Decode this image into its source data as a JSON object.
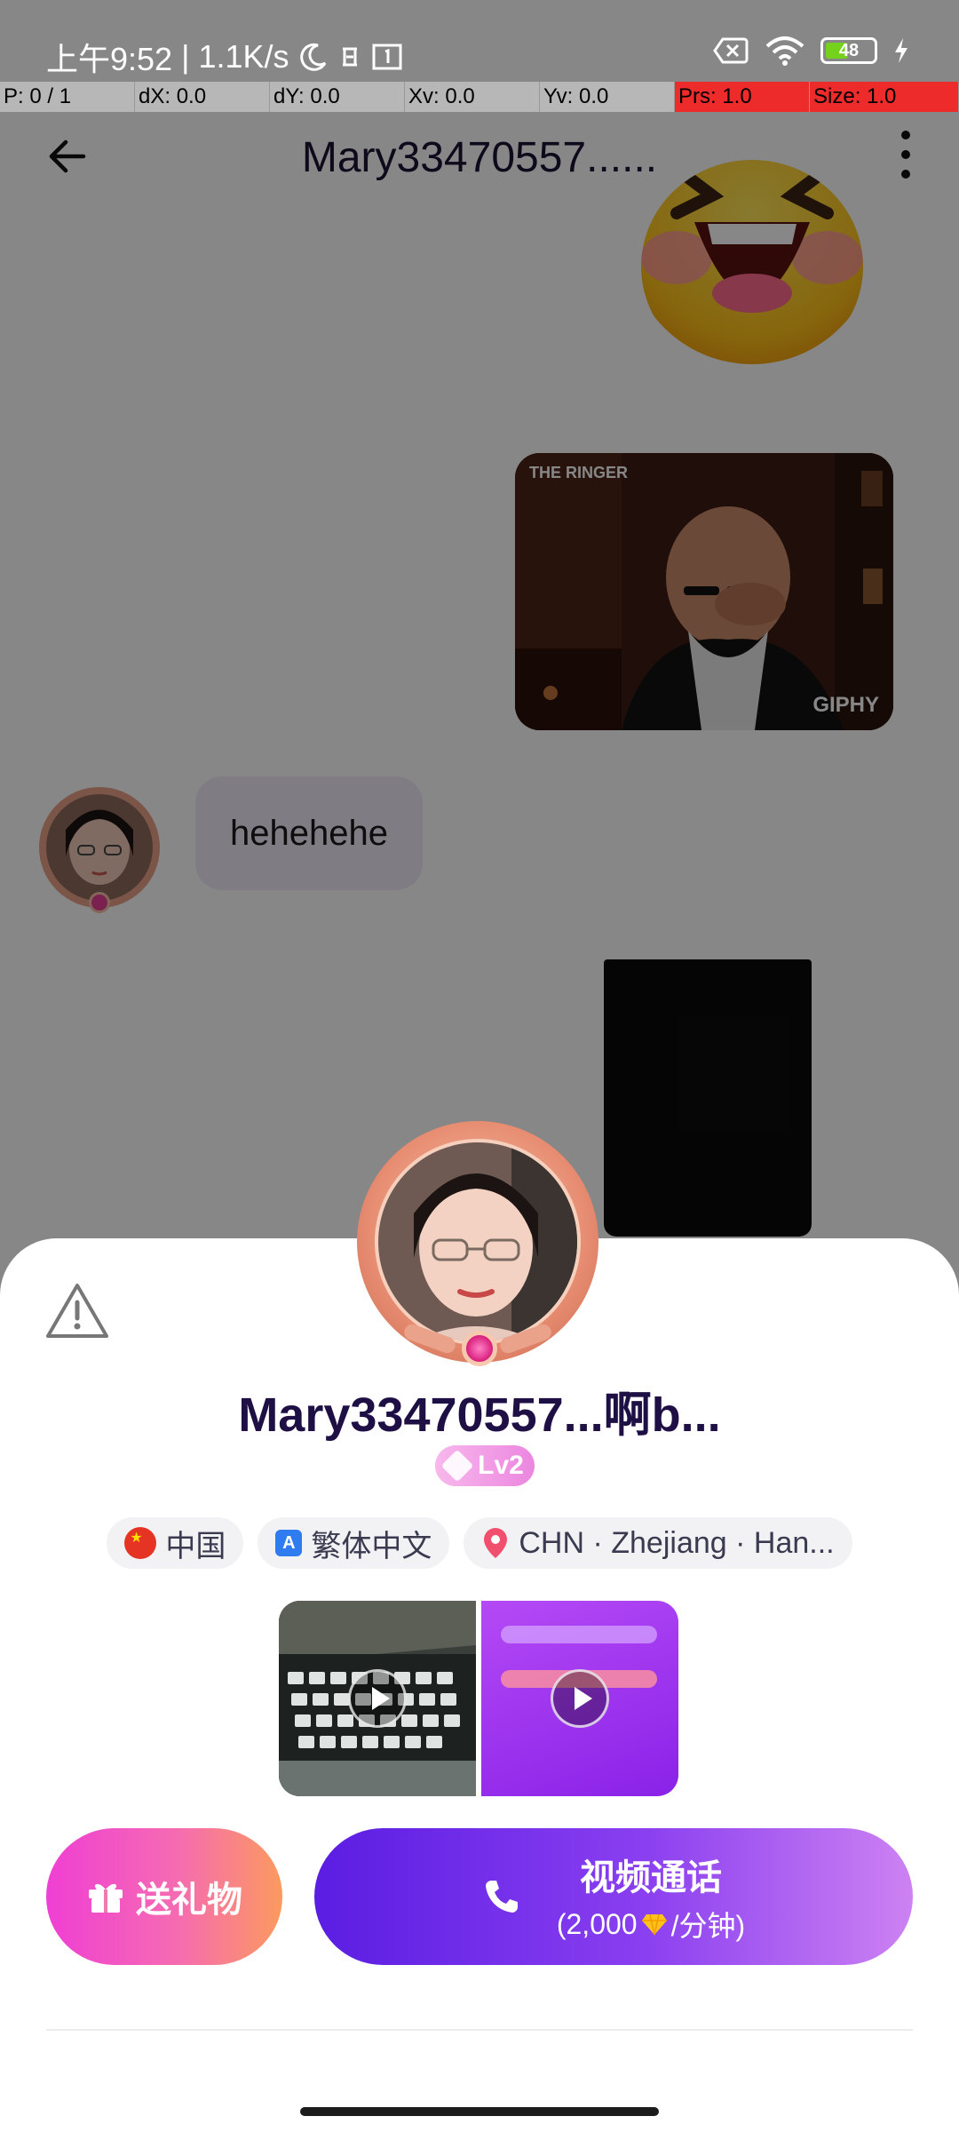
{
  "status_bar": {
    "time": "上午9:52",
    "separator": "|",
    "net_speed": "1.1K/s",
    "battery_level": "48",
    "battery_percent": 48,
    "icons": [
      "moon-icon",
      "sync-icon",
      "sim-icon",
      "no-sim-icon",
      "wifi-icon",
      "battery-icon",
      "charging-icon"
    ]
  },
  "debug_overlay": {
    "p": "P: 0 / 1",
    "dx": "dX: 0.0",
    "dy": "dY: 0.0",
    "xv": "Xv: 0.0",
    "yv": "Yv: 0.0",
    "prs": "Prs: 1.0",
    "size": "Size: 1.0"
  },
  "chat": {
    "title": "Mary33470557......",
    "messages": [
      {
        "type": "sticker",
        "direction": "outgoing",
        "desc": "laughing-emoji"
      },
      {
        "type": "gif",
        "direction": "outgoing",
        "source_badge": "THE RINGER",
        "powered_by": "GIPHY"
      },
      {
        "type": "text",
        "direction": "incoming",
        "text": "hehehehe"
      },
      {
        "type": "video",
        "direction": "outgoing"
      }
    ]
  },
  "profile_sheet": {
    "name": "Mary33470557...啊b...",
    "level": "Lv2",
    "tags": {
      "country": "中国",
      "language": "繁体中文",
      "location": "CHN · Zhejiang · Han..."
    },
    "media_count": 2,
    "gift_button_label": "送礼物",
    "video_call": {
      "label": "视频通话",
      "price_open": "(2,000",
      "price_unit": "/分钟)"
    }
  },
  "colors": {
    "accent_purple": "#5a1de2",
    "gift_pink": "#ef3fd4",
    "name_color": "#1e0f44",
    "level_pink": "#f8b8ec"
  }
}
